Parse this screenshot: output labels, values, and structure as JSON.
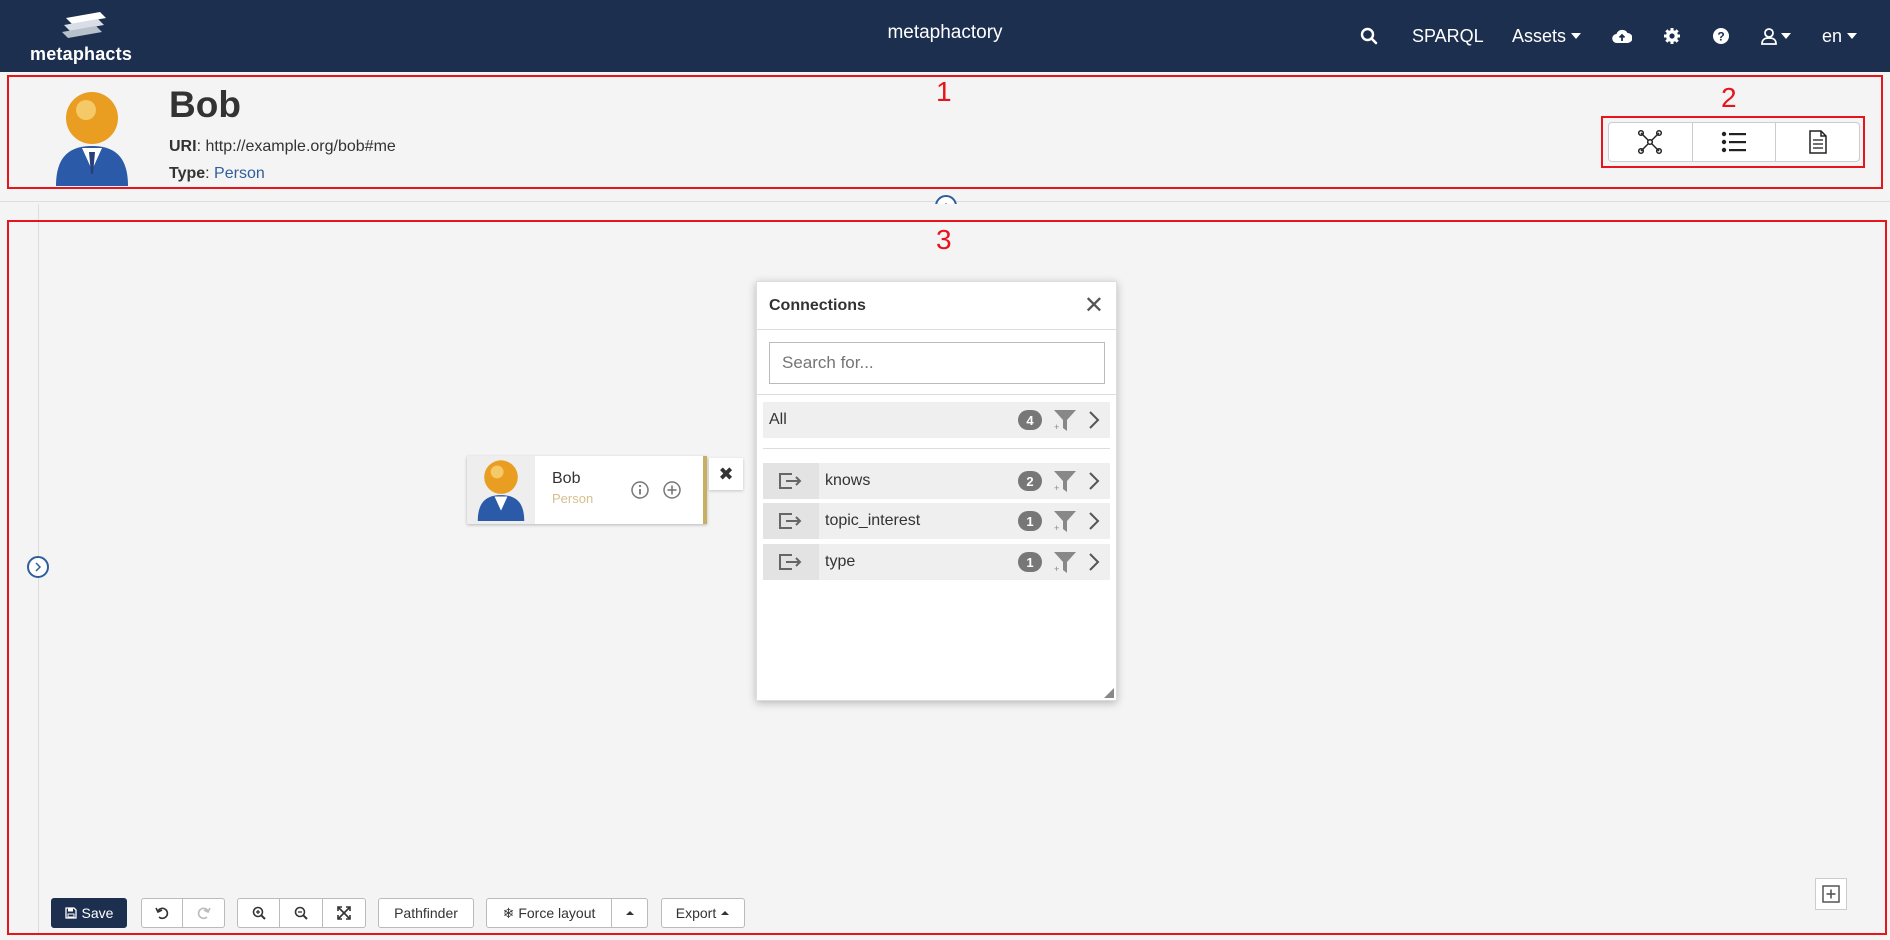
{
  "topbar": {
    "logo_text": "metaphacts",
    "app_title": "metaphactory",
    "nav": {
      "search_icon": "search-icon",
      "sparql": "SPARQL",
      "assets": "Assets",
      "upload_icon": "cloud-upload-icon",
      "settings_icon": "gear-icon",
      "help_icon": "question-circle-icon",
      "user_icon": "user-icon",
      "lang": "en"
    }
  },
  "header": {
    "name": "Bob",
    "uri_label": "URI",
    "uri_value": "http://example.org/bob#me",
    "type_label": "Type",
    "type_value": "Person"
  },
  "annotations": {
    "one": "1",
    "two": "2",
    "three": "3"
  },
  "node": {
    "name": "Bob",
    "type": "Person"
  },
  "connections": {
    "title": "Connections",
    "search_placeholder": "Search for...",
    "all": {
      "label": "All",
      "count": "4"
    },
    "items": [
      {
        "label": "knows",
        "count": "2"
      },
      {
        "label": "topic_interest",
        "count": "1"
      },
      {
        "label": "type",
        "count": "1"
      }
    ]
  },
  "toolbar": {
    "save": "Save",
    "pathfinder": "Pathfinder",
    "force_layout": "Force layout",
    "export": "Export"
  },
  "colors": {
    "navbar": "#1c2f4f",
    "annotation": "#e8141c",
    "link": "#2d5f9e",
    "node_accent": "#c8b063"
  }
}
